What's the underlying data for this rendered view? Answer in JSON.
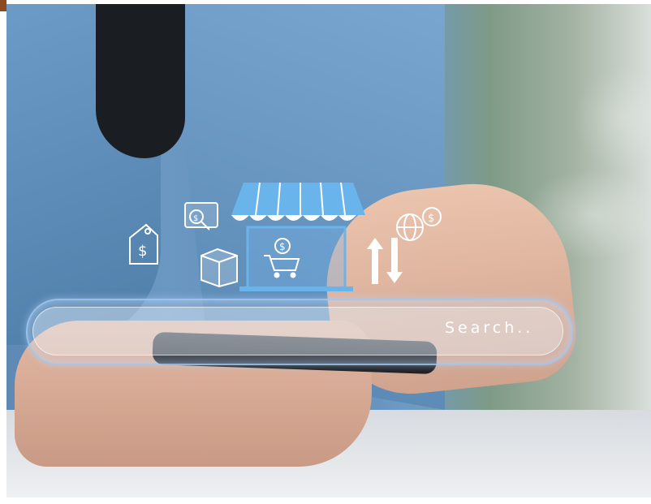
{
  "search": {
    "placeholder": "Search.."
  },
  "icons": [
    "price-tag-dollar-icon",
    "laptop-dollar-search-icon",
    "box-icon",
    "storefront-icon",
    "shopping-cart-dollar-icon",
    "up-down-arrows-icon",
    "globe-dollar-icon"
  ],
  "colors": {
    "jacket": "#6b98c2",
    "holo_accent": "#66b2ee",
    "search_border": "#a0c8f0"
  }
}
